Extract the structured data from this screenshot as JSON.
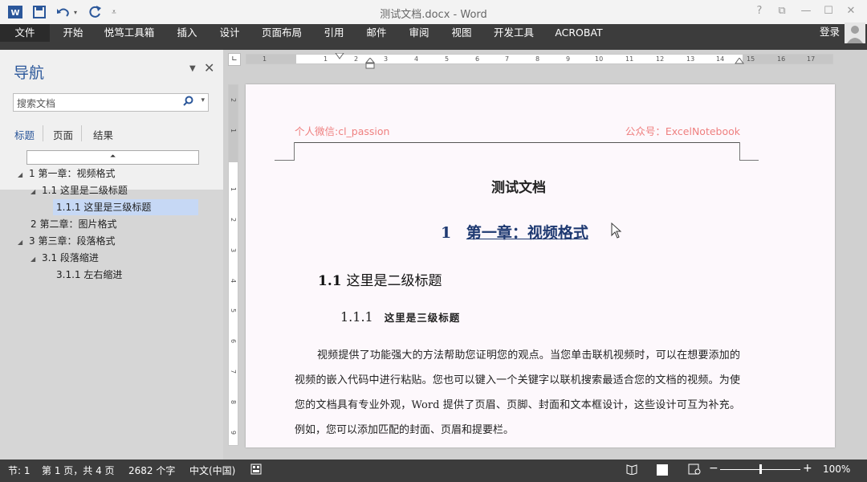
{
  "titlebar": {
    "title": "测试文档.docx - Word",
    "help": "?",
    "ribbon_display": "⧉",
    "minimize": "—",
    "restore": "☐",
    "close": "✕"
  },
  "quick_access": {
    "word_icon": "word-icon",
    "save": "save-icon",
    "undo": "undo-icon",
    "redo": "redo-icon",
    "customize": "customize-icon"
  },
  "tabs": [
    "文件",
    "开始",
    "悦笃工具箱",
    "插入",
    "设计",
    "页面布局",
    "引用",
    "邮件",
    "审阅",
    "视图",
    "开发工具",
    "ACROBAT"
  ],
  "login": "登录",
  "nav": {
    "title": "导航",
    "search_placeholder": "搜索文档",
    "tabs": [
      "标题",
      "页面",
      "结果"
    ],
    "tree": [
      {
        "label": "1 第一章：视频格式",
        "level": 1
      },
      {
        "label": "1.1 这里是二级标题",
        "level": 2
      },
      {
        "label": "1.1.1 这里是三级标题",
        "level": 3,
        "selected": true
      },
      {
        "label": "2 第二章：图片格式",
        "level": 1
      },
      {
        "label": "3 第三章：段落格式",
        "level": 1
      },
      {
        "label": "3.1 段落缩进",
        "level": 2
      },
      {
        "label": "3.1.1 左右缩进",
        "level": 3
      }
    ]
  },
  "ruler": {
    "h_numbers": [
      "1",
      "1",
      "2",
      "3",
      "4",
      "5",
      "6",
      "7",
      "8",
      "9",
      "10",
      "11",
      "12",
      "13",
      "14",
      "15",
      "16",
      "17"
    ],
    "v_numbers": [
      "2",
      "1",
      "1",
      "2",
      "3",
      "4",
      "5",
      "6",
      "7",
      "8",
      "9"
    ]
  },
  "document": {
    "header_left": "个人微信:cl_passion",
    "header_right": "公众号：ExcelNotebook",
    "title": "测试文档",
    "h1_num": "1",
    "h1_text": "第一章：视频格式",
    "h2_num": "1.1",
    "h2_text": "这里是二级标题",
    "h3_num": "1.1.1",
    "h3_text": "这里是三级标题",
    "paragraph": "视频提供了功能强大的方法帮助您证明您的观点。当您单击联机视频时，可以在想要添加的视频的嵌入代码中进行粘贴。您也可以键入一个关键字以联机搜索最适合您的文档的视频。为使您的文档具有专业外观，Word 提供了页眉、页脚、封面和文本框设计，这些设计可互为补充。例如，您可以添加匹配的封面、页眉和提要栏。"
  },
  "status": {
    "section": "节: 1",
    "page": "第 1 页，共 4 页",
    "words": "2682 个字",
    "language": "中文(中国)",
    "zoom": "100%",
    "zoom_minus": "−",
    "zoom_plus": "+",
    "zoom_fraction": 0.5
  }
}
